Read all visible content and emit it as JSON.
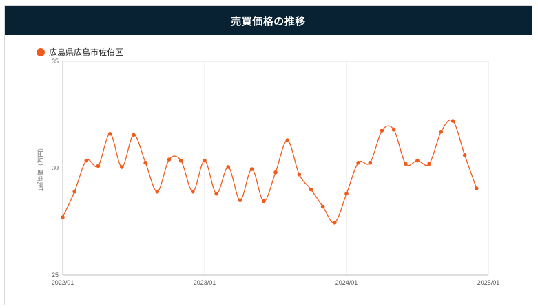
{
  "header": {
    "title": "売買価格の推移"
  },
  "chart_data": {
    "type": "line",
    "title": "売買価格の推移",
    "ylabel": "1㎡単価（万円）",
    "xlabel": "",
    "ylim": [
      25,
      35
    ],
    "yticks": [
      25,
      30,
      35
    ],
    "xticks": [
      "2022/01",
      "2023/01",
      "2024/01",
      "2025/01"
    ],
    "grid": true,
    "legend": "top-left",
    "series": [
      {
        "name": "広島県広島市佐伯区",
        "color": "#f15a1a",
        "x": [
          "2022/01",
          "2022/02",
          "2022/03",
          "2022/04",
          "2022/05",
          "2022/06",
          "2022/07",
          "2022/08",
          "2022/09",
          "2022/10",
          "2022/11",
          "2022/12",
          "2023/01",
          "2023/02",
          "2023/03",
          "2023/04",
          "2023/05",
          "2023/06",
          "2023/07",
          "2023/08",
          "2023/09",
          "2023/10",
          "2023/11",
          "2023/12",
          "2024/01",
          "2024/02",
          "2024/03",
          "2024/04",
          "2024/05",
          "2024/06",
          "2024/07",
          "2024/08",
          "2024/09",
          "2024/10",
          "2024/11",
          "2024/12"
        ],
        "values": [
          27.7,
          28.9,
          30.35,
          30.1,
          31.6,
          30.05,
          31.55,
          30.25,
          28.9,
          30.4,
          30.35,
          28.9,
          30.35,
          28.8,
          30.05,
          28.5,
          29.95,
          28.45,
          29.8,
          31.3,
          29.7,
          29.0,
          28.2,
          27.45,
          28.8,
          30.25,
          30.25,
          31.75,
          31.8,
          30.2,
          30.35,
          30.2,
          31.7,
          32.2,
          30.6,
          29.05
        ]
      }
    ]
  }
}
